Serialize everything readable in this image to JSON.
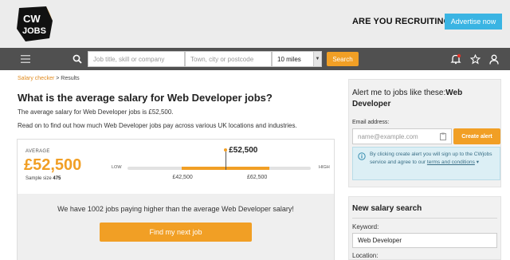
{
  "header": {
    "logo_text": "CW JOBS",
    "recruiting_text": "ARE YOU RECRUITING?",
    "advertise_label": "Advertise now"
  },
  "navbar": {
    "menu_icon": "hamburger-icon",
    "search_icon": "search-icon",
    "keyword_placeholder": "Job title, skill or company",
    "location_placeholder": "Town, city or postcode",
    "radius_value": "10 miles",
    "search_label": "Search",
    "icons": [
      "bell-icon",
      "star-icon",
      "user-icon"
    ]
  },
  "breadcrumb": {
    "link": "Salary checker",
    "separator": " > ",
    "current": "Results"
  },
  "main": {
    "title": "What is the average salary for Web Developer jobs?",
    "para1": "The average salary for Web Developer jobs is £52,500.",
    "para2": "Read on to find out how much Web Developer jobs pay across various UK locations and industries."
  },
  "salary_card": {
    "avg_label": "AVERAGE",
    "avg_value": "£52,500",
    "sample_label": "Sample size ",
    "sample_size": "475",
    "low_label": "LOW",
    "high_label": "HIGH",
    "range_low": "£42,500",
    "range_high": "£62,500",
    "marker_value": "£52,500",
    "scale": {
      "min": 30000,
      "max": 72000,
      "low": 42500,
      "high": 62500,
      "avg": 52500
    },
    "higher_text": "We have 1002 jobs paying higher than the average Web Developer salary!",
    "find_label": "Find my next job"
  },
  "alert": {
    "title_prefix": "Alert me to jobs like these:",
    "title_bold": "Web Developer",
    "email_label": "Email address:",
    "email_placeholder": "name@example.com",
    "create_label": "Create alert",
    "info_text_1": "By clicking create alert you will sign up to the CWjobs service and agree to our ",
    "info_link": "terms and conditions",
    "info_icon": "info-icon"
  },
  "new_search": {
    "title": "New salary search",
    "keyword_label": "Keyword:",
    "keyword_value": "Web Developer",
    "location_label": "Location:"
  },
  "colors": {
    "accent": "#f19f25",
    "navbar": "#505050",
    "advertise": "#3ab4e3",
    "info_bg": "#dceff5"
  }
}
